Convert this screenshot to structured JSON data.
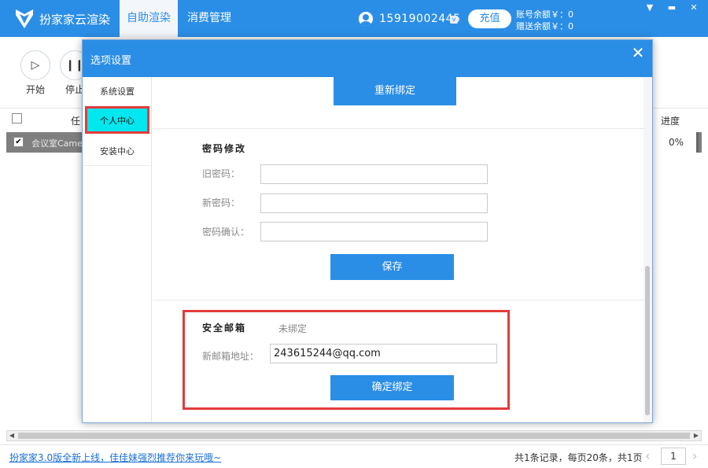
{
  "app": {
    "name": "扮家家云渲染",
    "tabs": [
      {
        "label": "自助渲染",
        "active": true
      },
      {
        "label": "消费管理",
        "active": false
      }
    ],
    "phone": "15919002445",
    "vip_badge": "v",
    "recharge_label": "充值",
    "balance_account": "账号余额￥：0",
    "balance_gift": "赠送余额￥：0",
    "window_controls": [
      "minimize",
      "close"
    ]
  },
  "toolbar": {
    "start_label": "开始",
    "stop_label": "停止"
  },
  "table": {
    "header_task_fragment": "任",
    "header_progress": "进度",
    "rows": [
      {
        "checked": true,
        "name": "会议室Came",
        "progress": "0%"
      }
    ]
  },
  "statusbar": {
    "promo_text": "扮家家3.0版全新上线，佳佳妹强烈推荐你来玩哦~",
    "page_info": "共1条记录，每页20条，共1页",
    "page_number": "1"
  },
  "modal": {
    "title": "选项设置",
    "sidebar": [
      {
        "label": "系统设置",
        "active": false
      },
      {
        "label": "个人中心",
        "active": true
      },
      {
        "label": "安装中心",
        "active": false
      }
    ],
    "rebind_label": "重新绑定",
    "password": {
      "title": "密码修改",
      "old_label": "旧密码：",
      "new_label": "新密码：",
      "confirm_label": "密码确认：",
      "old_value": "",
      "new_value": "",
      "confirm_value": "",
      "save_label": "保存"
    },
    "email": {
      "title": "安全邮箱",
      "status": "未绑定",
      "field_label": "新邮箱地址：",
      "field_value": "243615244@qq.com",
      "confirm_label": "确定绑定"
    }
  },
  "colors": {
    "brand_blue": "#2b8ee6",
    "highlight_red": "#e43b3b",
    "active_cyan": "#00e7ef"
  }
}
